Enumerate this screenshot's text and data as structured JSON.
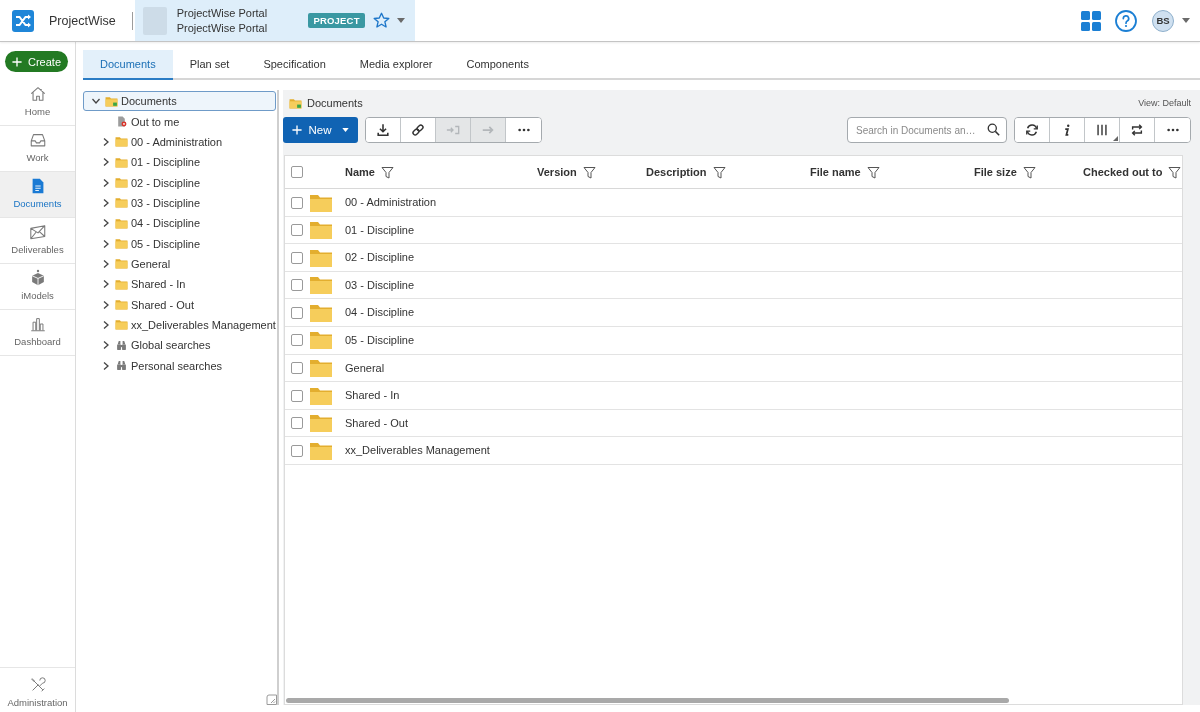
{
  "header": {
    "app_name": "ProjectWise",
    "context": {
      "lines": [
        "ProjectWise Portal",
        "ProjectWise Portal"
      ],
      "badge": "PROJECT",
      "favorite": false
    },
    "user_initials": "BS"
  },
  "sidebar": {
    "create_button": "Create",
    "items": [
      {
        "label": "Home",
        "kind": "home",
        "selected": false
      },
      {
        "label": "Work",
        "kind": "inbox",
        "selected": false
      },
      {
        "label": "Documents",
        "kind": "document",
        "selected": true
      },
      {
        "label": "Deliverables",
        "kind": "envelope",
        "selected": false
      },
      {
        "label": "iModels",
        "kind": "cube",
        "selected": false
      },
      {
        "label": "Dashboard",
        "kind": "chart",
        "selected": false
      }
    ],
    "footer_item": {
      "label": "Administration",
      "kind": "tools",
      "selected": false
    }
  },
  "tabs": [
    {
      "label": "Documents",
      "selected": true
    },
    {
      "label": "Plan set",
      "selected": false
    },
    {
      "label": "Specification",
      "selected": false
    },
    {
      "label": "Media explorer",
      "selected": false
    },
    {
      "label": "Components",
      "selected": false
    }
  ],
  "tree": {
    "items": [
      {
        "label": "Documents",
        "kind": "project",
        "selected": true,
        "expanded": true,
        "children": [
          {
            "label": "Out to me",
            "kind": "checkout",
            "selected": false
          },
          {
            "label": "00 - Administration",
            "kind": "folder",
            "selected": false,
            "expanded": false
          },
          {
            "label": "01 - Discipline",
            "kind": "folder",
            "selected": false,
            "expanded": false
          },
          {
            "label": "02 - Discipline",
            "kind": "folder",
            "selected": false,
            "expanded": false
          },
          {
            "label": "03 - Discipline",
            "kind": "folder",
            "selected": false,
            "expanded": false
          },
          {
            "label": "04 - Discipline",
            "kind": "folder",
            "selected": false,
            "expanded": false
          },
          {
            "label": "05 - Discipline",
            "kind": "folder",
            "selected": false,
            "expanded": false
          },
          {
            "label": "General",
            "kind": "folder",
            "selected": false,
            "expanded": false
          },
          {
            "label": "Shared - In",
            "kind": "folder",
            "selected": false,
            "expanded": false
          },
          {
            "label": "Shared - Out",
            "kind": "folder",
            "selected": false,
            "expanded": false
          },
          {
            "label": "xx_Deliverables Management",
            "kind": "folder",
            "selected": false,
            "expanded": false
          },
          {
            "label": "Global searches",
            "kind": "search",
            "selected": false,
            "expanded": false
          },
          {
            "label": "Personal searches",
            "kind": "search",
            "selected": false,
            "expanded": false
          }
        ]
      }
    ]
  },
  "content": {
    "breadcrumb": "Documents",
    "view_label": "View: Default",
    "new_button": "New",
    "actions": [
      {
        "kind": "download",
        "disabled": false
      },
      {
        "kind": "link",
        "disabled": false
      },
      {
        "kind": "checkout",
        "disabled": true
      },
      {
        "kind": "forward",
        "disabled": true
      },
      {
        "kind": "more",
        "disabled": false
      }
    ],
    "search": {
      "placeholder": "Search in Documents an…"
    },
    "view_actions": [
      {
        "kind": "refresh"
      },
      {
        "kind": "info"
      },
      {
        "kind": "columns"
      },
      {
        "kind": "swap"
      },
      {
        "kind": "more"
      }
    ],
    "table": {
      "select_all_checked": false,
      "columns": [
        "Name",
        "Version",
        "Description",
        "File name",
        "File size",
        "Checked out to"
      ],
      "rows": [
        {
          "name": "00 - Administration",
          "checked": false
        },
        {
          "name": "01 - Discipline",
          "checked": false
        },
        {
          "name": "02 - Discipline",
          "checked": false
        },
        {
          "name": "03 - Discipline",
          "checked": false
        },
        {
          "name": "04 - Discipline",
          "checked": false
        },
        {
          "name": "05 - Discipline",
          "checked": false
        },
        {
          "name": "General",
          "checked": false
        },
        {
          "name": "Shared - In",
          "checked": false
        },
        {
          "name": "Shared - Out",
          "checked": false
        },
        {
          "name": "xx_Deliverables Management",
          "checked": false
        }
      ]
    }
  }
}
